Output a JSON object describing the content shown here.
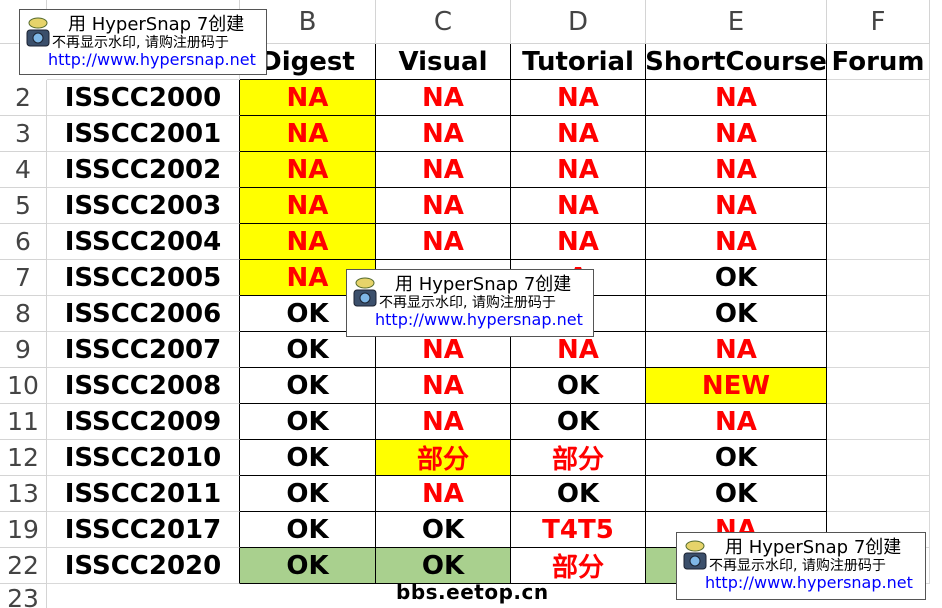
{
  "columns": [
    "B",
    "C",
    "D",
    "E",
    "F"
  ],
  "header_row": {
    "A": "",
    "B": "Digest",
    "C": "Visual",
    "D": "Tutorial",
    "E": "ShortCourse",
    "F": "Forum"
  },
  "rows": [
    {
      "num": "2",
      "name": "ISSCC2000",
      "B": "NA",
      "C": "NA",
      "D": "NA",
      "E": "NA"
    },
    {
      "num": "3",
      "name": "ISSCC2001",
      "B": "NA",
      "C": "NA",
      "D": "NA",
      "E": "NA"
    },
    {
      "num": "4",
      "name": "ISSCC2002",
      "B": "NA",
      "C": "NA",
      "D": "NA",
      "E": "NA"
    },
    {
      "num": "5",
      "name": "ISSCC2003",
      "B": "NA",
      "C": "NA",
      "D": "NA",
      "E": "NA"
    },
    {
      "num": "6",
      "name": "ISSCC2004",
      "B": "NA",
      "C": "NA",
      "D": "NA",
      "E": "NA"
    },
    {
      "num": "7",
      "name": "ISSCC2005",
      "B": "NA",
      "C": "",
      "D": "A",
      "E": "OK"
    },
    {
      "num": "8",
      "name": "ISSCC2006",
      "B": "OK",
      "C": "",
      "D": "",
      "E": "OK"
    },
    {
      "num": "9",
      "name": "ISSCC2007",
      "B": "OK",
      "C": "NA",
      "D": "NA",
      "E": "NA"
    },
    {
      "num": "10",
      "name": "ISSCC2008",
      "B": "OK",
      "C": "NA",
      "D": "OK",
      "E": "NEW"
    },
    {
      "num": "11",
      "name": "ISSCC2009",
      "B": "OK",
      "C": "NA",
      "D": "OK",
      "E": "NA"
    },
    {
      "num": "12",
      "name": "ISSCC2010",
      "B": "OK",
      "C": "部分",
      "D": "部分",
      "E": "OK"
    },
    {
      "num": "13",
      "name": "ISSCC2011",
      "B": "OK",
      "C": "NA",
      "D": "OK",
      "E": "OK"
    },
    {
      "num": "19",
      "name": "ISSCC2017",
      "B": "OK",
      "C": "OK",
      "D": "T4T5",
      "E": "NA"
    },
    {
      "num": "22",
      "name": "ISSCC2020",
      "B": "OK",
      "C": "OK",
      "D": "部分",
      "E": ""
    }
  ],
  "last_row_num": "23",
  "watermark": {
    "title": "用 HyperSnap 7创建",
    "subtitle": "不再显示水印, 请购注册码于",
    "url": "http://www.hypersnap.net"
  },
  "footer_mark": "bbs.eetop.cn",
  "colors": {
    "highlight_yellow": "#ffff00",
    "highlight_green": "#a9d08e",
    "na_red": "#ff0000",
    "url_blue": "#0000ff"
  }
}
